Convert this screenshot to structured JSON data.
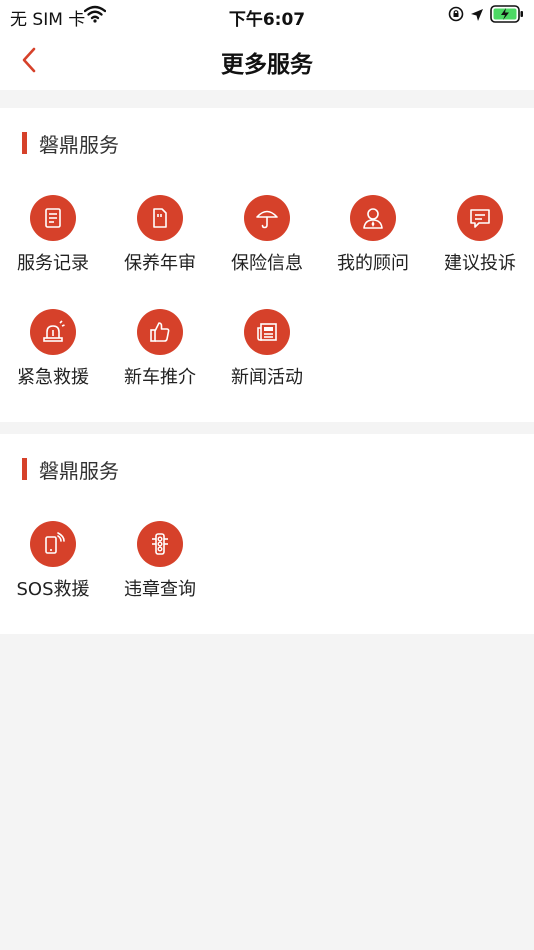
{
  "status": {
    "carrier": "无 SIM 卡",
    "time": "下午6:07"
  },
  "nav": {
    "title": "更多服务"
  },
  "sections": [
    {
      "title": "磐鼎服务",
      "items": [
        {
          "label": "服务记录",
          "icon": "document-icon"
        },
        {
          "label": "保养年审",
          "icon": "file-icon"
        },
        {
          "label": "保险信息",
          "icon": "umbrella-icon"
        },
        {
          "label": "我的顾问",
          "icon": "advisor-icon"
        },
        {
          "label": "建议投诉",
          "icon": "message-icon"
        },
        {
          "label": "紧急救援",
          "icon": "siren-icon"
        },
        {
          "label": "新车推介",
          "icon": "thumbs-up-icon"
        },
        {
          "label": "新闻活动",
          "icon": "newspaper-icon"
        }
      ]
    },
    {
      "title": "磐鼎服务",
      "items": [
        {
          "label": "SOS救援",
          "icon": "phone-signal-icon"
        },
        {
          "label": "违章查询",
          "icon": "traffic-light-icon"
        }
      ]
    }
  ],
  "colors": {
    "accent": "#d6412a",
    "background": "#f4f4f4"
  }
}
